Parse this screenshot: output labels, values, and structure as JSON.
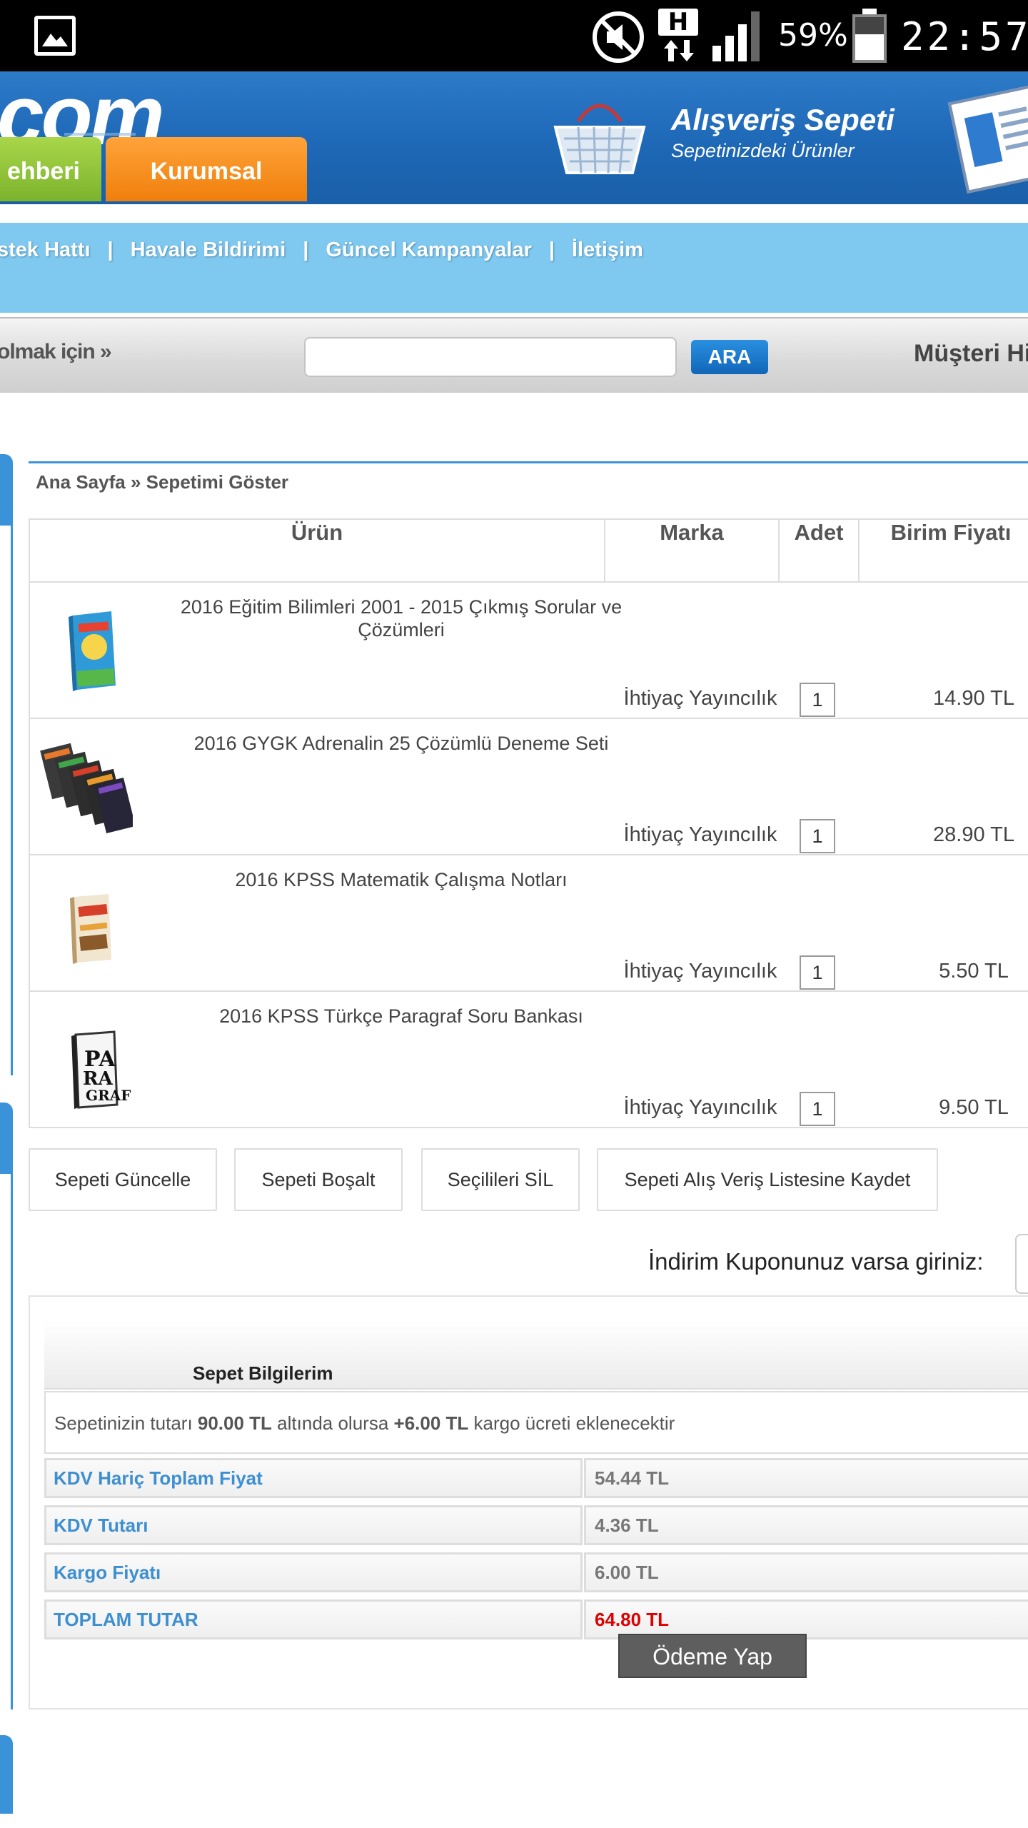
{
  "status_bar": {
    "network_type": "H",
    "battery_percent": "59%",
    "time": "22:57"
  },
  "header": {
    "logo_text": "com",
    "tabs": [
      {
        "label": "ehberi"
      },
      {
        "label": "Kurumsal"
      }
    ],
    "cart_title": "Alışveriş Sepeti",
    "cart_subtitle": "Sepetinizdeki Ürünler"
  },
  "links": [
    "stek Hattı",
    "Havale Bildirimi",
    "Güncel Kampanyalar",
    "İletişim"
  ],
  "link_separator": "|",
  "search": {
    "left_text": "olmak için »",
    "button_label": "ARA",
    "placeholder": "",
    "right_text": "Müşteri Hiz"
  },
  "breadcrumb": "Ana Sayfa » Sepetimi Göster",
  "table": {
    "headers": [
      "Ürün",
      "Marka",
      "Adet",
      "Birim Fiyatı"
    ],
    "rows": [
      {
        "name": "2016 Eğitim Bilimleri 2001 - 2015 Çıkmış Sorular ve Çözümleri",
        "brand": "İhtiyaç Yayıncılık",
        "qty": "1",
        "price": "14.90 TL"
      },
      {
        "name": "2016 GYGK Adrenalin 25 Çözümlü Deneme Seti",
        "brand": "İhtiyaç Yayıncılık",
        "qty": "1",
        "price": "28.90 TL"
      },
      {
        "name": "2016 KPSS Matematik Çalışma Notları",
        "brand": "İhtiyaç Yayıncılık",
        "qty": "1",
        "price": "5.50 TL"
      },
      {
        "name": "2016 KPSS Türkçe Paragraf Soru Bankası",
        "brand": "İhtiyaç Yayıncılık",
        "qty": "1",
        "price": "9.50 TL"
      }
    ]
  },
  "actions": {
    "update": "Sepeti Güncelle",
    "empty": "Sepeti Boşalt",
    "delete_selected": "Seçilileri SİL",
    "save_list": "Sepeti Alış Veriş Listesine Kaydet"
  },
  "coupon_label": "İndirim Kuponunuz varsa giriniz:",
  "summary": {
    "title": "Sepet Bilgilerim",
    "note_prefix": "Sepetinizin tutarı ",
    "note_threshold": "90.00 TL",
    "note_mid": " altında olursa ",
    "note_fee": "+6.00 TL",
    "note_suffix": " kargo ücreti eklenecektir",
    "rows": [
      {
        "label": "KDV Hariç Toplam Fiyat",
        "value": "54.44 TL"
      },
      {
        "label": "KDV Tutarı",
        "value": "4.36 TL"
      },
      {
        "label": "Kargo Fiyatı",
        "value": "6.00 TL"
      },
      {
        "label": "TOPLAM TUTAR",
        "value": "64.80 TL"
      }
    ],
    "pay_button": "Ödeme Yap"
  }
}
